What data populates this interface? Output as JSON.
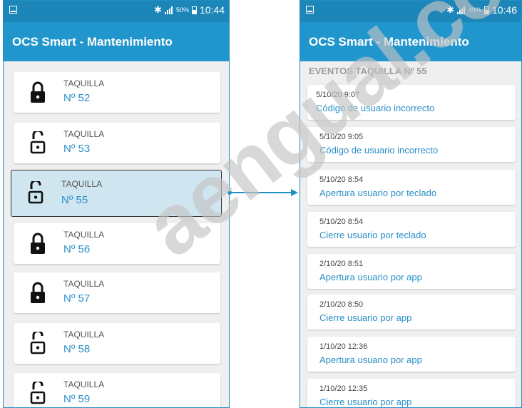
{
  "status_left": {
    "battery_pct": "50%",
    "time": "10:44"
  },
  "status_right": {
    "battery_pct": "49%",
    "time": "10:46"
  },
  "app_title": "OCS Smart - Mantenimiento",
  "lockers": [
    {
      "title": "TAQUILLA",
      "number": "Nº 52",
      "locked": true
    },
    {
      "title": "TAQUILLA",
      "number": "Nº 53",
      "locked": false
    },
    {
      "title": "TAQUILLA",
      "number": "Nº 55",
      "locked": false,
      "selected": true
    },
    {
      "title": "TAQUILLA",
      "number": "Nº 56",
      "locked": true
    },
    {
      "title": "TAQUILLA",
      "number": "Nº 57",
      "locked": true
    },
    {
      "title": "TAQUILLA",
      "number": "Nº 58",
      "locked": false
    },
    {
      "title": "TAQUILLA",
      "number": "Nº 59",
      "locked": false
    }
  ],
  "events_header": "EVENTOS TAQUILLA Nº 55",
  "events": [
    {
      "date": "5/10/20 9:07",
      "desc": "Código de usuario incorrecto"
    },
    {
      "date": "5/10/20 9:05",
      "desc": "Código de usuario incorrecto"
    },
    {
      "date": "5/10/20 8:54",
      "desc": "Apertura usuario por teclado"
    },
    {
      "date": "5/10/20 8:54",
      "desc": "Cierre usuario por teclado"
    },
    {
      "date": "2/10/20 8:51",
      "desc": "Apertura usuario por app"
    },
    {
      "date": "2/10/20 8:50",
      "desc": "Cierre usuario por app"
    },
    {
      "date": "1/10/20 12:36",
      "desc": "Apertura usuario por app"
    },
    {
      "date": "1/10/20 12:35",
      "desc": "Cierre usuario por app"
    }
  ],
  "watermark": "aengual.com",
  "colors": {
    "primary": "#2196cd",
    "statusbar": "#1d86b8",
    "accent_text": "#2a90c8",
    "selected_bg": "#cfe5ef"
  }
}
